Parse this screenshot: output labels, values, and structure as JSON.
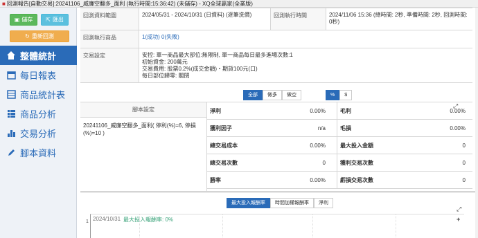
{
  "window": {
    "title": "回測報告[自動交易]:20241106_威廉空翻多_面利 (執行時間:15:36:42) (未儲存) - XQ全球贏家(全業版)"
  },
  "toolbar": {
    "save_label": "儲存",
    "export_label": "匯出",
    "rerun_label": "重新回測"
  },
  "nav": {
    "items": [
      {
        "label": "整體統計",
        "icon": "dashboard-icon"
      },
      {
        "label": "每日報表",
        "icon": "calendar-icon"
      },
      {
        "label": "商品統計表",
        "icon": "table-icon"
      },
      {
        "label": "商品分析",
        "icon": "list-icon"
      },
      {
        "label": "交易分析",
        "icon": "bar-chart-icon"
      },
      {
        "label": "腳本資料",
        "icon": "pencil-icon"
      }
    ]
  },
  "info": {
    "range_label": "回測資料範圍",
    "range_value": "2024/05/31 - 2024/10/31 (日資料) (逐筆洗價)",
    "exec_label": "回測執行時間",
    "exec_value": "2024/11/06 15:36 (總時間: 2秒, 準備時間: 2秒, 回測時間: 0秒)",
    "products_label": "回測執行商品",
    "products_success": "1(成功)",
    "products_fail": "0(失敗)",
    "trade_label": "交易設定",
    "trade_lines": [
      "安控: 單一商品最大部位:無限制, 單一商品每日最多進場次數:1",
      "初始資金: 200萬元",
      "交易費用: 股票0.2%(成交金額)・期貨100元(口)",
      "每日部位歸零: 關閉"
    ]
  },
  "filters": {
    "direction": [
      "全部",
      "做多",
      "做空"
    ],
    "direction_active": "全部",
    "unit": [
      "%",
      "$"
    ],
    "unit_active": "%"
  },
  "script": {
    "header": "腳本設定",
    "value": "20241106_威廉空翻多_面利( 停利(%)=6, 停損(%)=10 )"
  },
  "metrics": [
    {
      "label": "淨利",
      "value": "0.00%",
      "label2": "毛利",
      "value2": "0.00%"
    },
    {
      "label": "獲利因子",
      "value": "n/a",
      "label2": "毛損",
      "value2": "0.00%"
    },
    {
      "label": "總交易成本",
      "value": "0.00%",
      "label2": "最大投入金額",
      "value2": "0"
    },
    {
      "label": "總交易次數",
      "value": "0",
      "label2": "獲利交易次數",
      "value2": "0"
    },
    {
      "label": "勝率",
      "value": "0.00%",
      "label2": "虧損交易次數",
      "value2": "0"
    }
  ],
  "chart_tabs": {
    "items": [
      "最大投入報酬率",
      "時間加權報酬率",
      "淨利"
    ],
    "active": "最大投入報酬率"
  },
  "chart_data": {
    "type": "line",
    "date_label": "2024/10/31",
    "legend": "最大投入報酬率: 0%",
    "y_tick": "1",
    "series": [
      {
        "name": "最大投入報酬率",
        "values": [
          0
        ]
      }
    ]
  },
  "colors": {
    "accent": "#2a6bb8",
    "save": "#5cb85c",
    "export": "#5bc0de",
    "rerun": "#f0ad4e",
    "legend": "#3aa37a"
  }
}
